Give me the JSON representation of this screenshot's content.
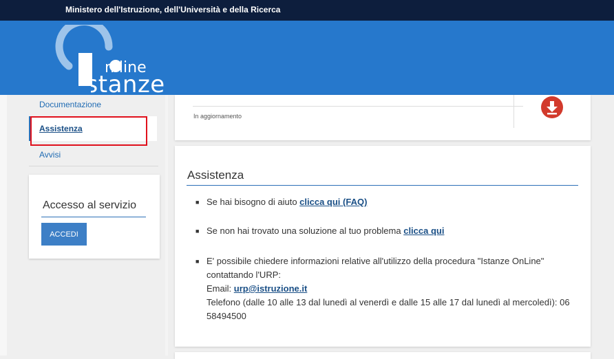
{
  "header": {
    "ministry": "Ministero dell'Istruzione, dell'Università e della Ricerca",
    "logo_line1": "n line",
    "logo_line2": "Istanze",
    "bg_color": "#2678cc",
    "topbar_color": "#0d1e3d"
  },
  "sidebar": {
    "items": [
      {
        "label": "Documentazione"
      },
      {
        "label": "Assistenza",
        "active": true
      },
      {
        "label": "Avvisi"
      }
    ],
    "access": {
      "title": "Accesso al servizio",
      "button": "ACCEDI"
    }
  },
  "status_card": {
    "status_text": "In aggiornamento",
    "icon": "download-icon",
    "icon_color": "#d23a2c"
  },
  "assistenza": {
    "title": "Assistenza",
    "item1_text": "Se hai bisogno di aiuto",
    "item1_link": "clicca qui (FAQ)",
    "item2_text": "Se non hai trovato una soluzione al tuo problema",
    "item2_link": "clicca qui",
    "item3_line1": "E' possibile chiedere informazioni relative all'utilizzo della procedura \"Istanze OnLine\" contattando l'URP:",
    "item3_email_label": "Email:",
    "item3_email": "urp@istruzione.it",
    "item3_phone": "Telefono (dalle 10 alle 13 dal lunedì al venerdì e dalle 15 alle 17 dal lunedì al mercoledì): 06 58494500"
  },
  "annotation": {
    "highlight_color": "#e0101b"
  }
}
